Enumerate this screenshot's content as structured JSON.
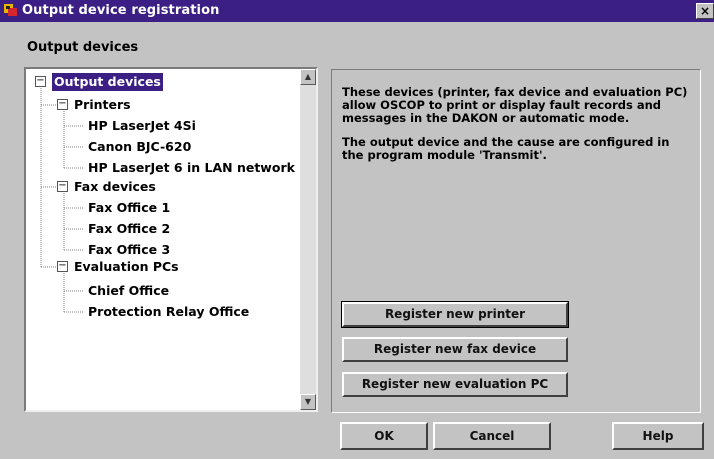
{
  "window": {
    "title": "Output device registration",
    "close_label": "×"
  },
  "group_label": "Output devices",
  "tree": {
    "root": "Output devices",
    "groups": [
      {
        "label": "Printers",
        "children": [
          "HP LaserJet 4Si",
          "Canon BJC-620",
          "HP LaserJet 6 in LAN network"
        ]
      },
      {
        "label": "Fax devices",
        "children": [
          "Fax Office 1",
          "Fax Office 2",
          "Fax Office 3"
        ]
      },
      {
        "label": "Evaluation PCs",
        "children": [
          "Chief Office",
          "Protection Relay Office"
        ]
      }
    ],
    "expander_symbol": "−"
  },
  "scrollbar": {
    "up_symbol": "▲",
    "down_symbol": "▼"
  },
  "info": {
    "paragraph1": "These devices (printer, fax device and evaluation PC) allow OSCOP to print or display fault records and messages in the DAKON or automatic mode.",
    "paragraph2": "The output device and the cause are configured in the program module 'Transmit'."
  },
  "actions": {
    "register_printer": "Register new printer",
    "register_fax": "Register new fax device",
    "register_pc": "Register new evaluation PC"
  },
  "footer": {
    "ok": "OK",
    "cancel": "Cancel",
    "help": "Help"
  },
  "colors": {
    "titlebar": "#3b1f84",
    "face": "#c3c3c3",
    "selection": "#3b1f84"
  }
}
